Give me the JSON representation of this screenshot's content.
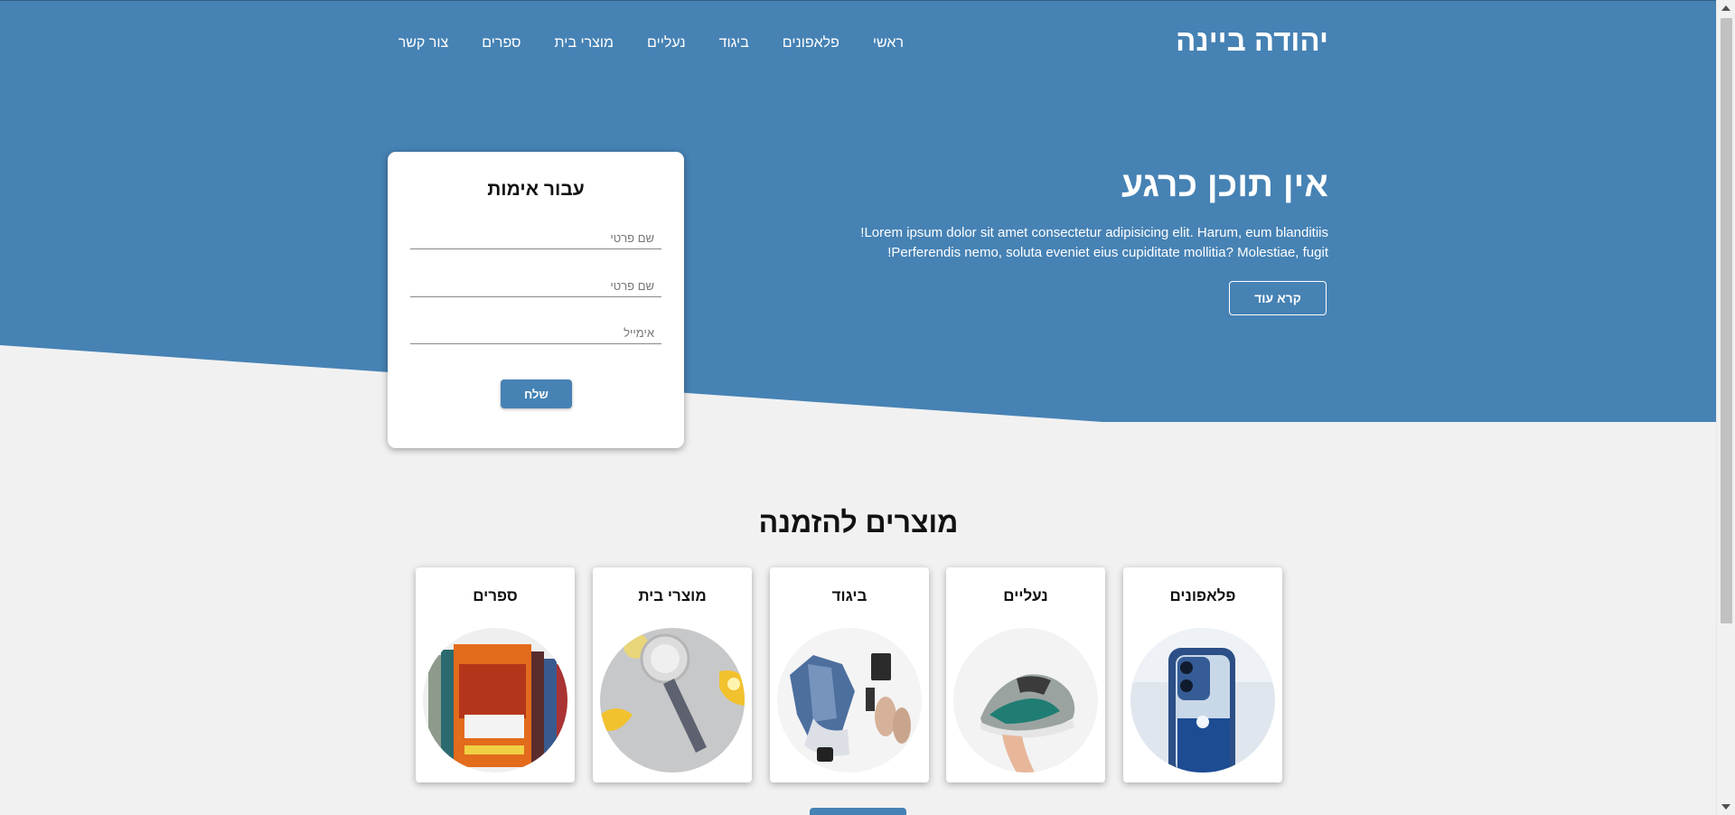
{
  "header": {
    "logo": "יהודה ביינה",
    "nav": [
      "ראשי",
      "פלאפונים",
      "ביגוד",
      "נעליים",
      "מוצרי בית",
      "ספרים",
      "צור קשר"
    ]
  },
  "hero": {
    "title": "אין תוכן כרגע",
    "text_line1": "Lorem ipsum dolor sit amet consectetur adipisicing elit. Harum, eum blanditiis!",
    "text_line2": "Perferendis nemo, soluta eveniet eius cupiditate mollitia? Molestiae, fugit!",
    "button": "קרא עוד"
  },
  "form": {
    "title": "עבור אימות",
    "field1_placeholder": "שם פרטי",
    "field2_placeholder": "שם פרטי",
    "field3_placeholder": "אימייל",
    "submit": "שלח"
  },
  "products": {
    "title": "מוצרים להזמנה",
    "items": [
      {
        "label": "פלאפונים",
        "icon": "phone-image"
      },
      {
        "label": "נעליים",
        "icon": "sneaker-image"
      },
      {
        "label": "ביגוד",
        "icon": "clothing-image"
      },
      {
        "label": "מוצרי בית",
        "icon": "juicer-image"
      },
      {
        "label": "ספרים",
        "icon": "books-image"
      }
    ]
  },
  "colors": {
    "primary": "#4682b4",
    "background": "#f1f1f1"
  }
}
